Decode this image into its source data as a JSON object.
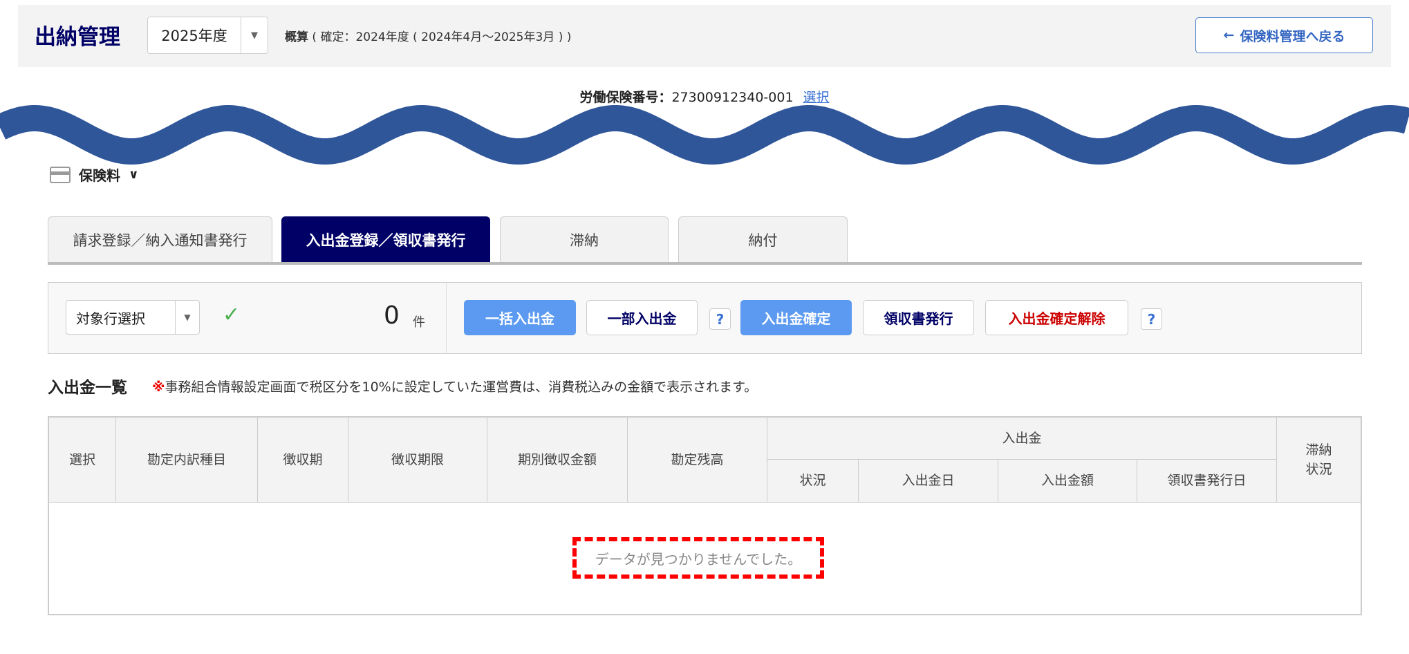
{
  "header": {
    "title": "出納管理",
    "year": "2025年度",
    "gaisan_label": "概算",
    "gaisan_detail": "( 確定：2024年度 ( 2024年4月～2025年3月 ) )",
    "back_button": "保険料管理へ戻る"
  },
  "insurance": {
    "label": "労働保険番号：",
    "number": "27300912340-001",
    "select_link": "選択"
  },
  "section": {
    "title": "保険料"
  },
  "tabs": [
    {
      "label": "請求登録／納入通知書発行"
    },
    {
      "label": "入出金登録／領収書発行",
      "active": true
    },
    {
      "label": "滞納"
    },
    {
      "label": "納付"
    }
  ],
  "toolbar": {
    "row_select": "対象行選択",
    "count": "0",
    "count_unit": "件",
    "buttons": [
      "一括入出金",
      "一部入出金",
      "入出金確定",
      "領収書発行",
      "入出金確定解除"
    ],
    "help": "?"
  },
  "list": {
    "title": "入出金一覧",
    "note_mark": "※",
    "note": "事務組合情報設定画面で税区分を10%に設定していた運営費は、消費税込みの金額で表示されます。"
  },
  "table": {
    "headers": [
      "選択",
      "勘定内訳種目",
      "徴収期",
      "徴収期限",
      "期別徴収金額",
      "勘定残高"
    ],
    "group": "入出金",
    "sub_headers": [
      "状況",
      "入出金日",
      "入出金額",
      "領収書発行日"
    ],
    "last": "滞納\n状況",
    "empty": "データが見つかりませんでした。"
  },
  "colors": {
    "navy": "#000066",
    "accent_blue": "#5b9af0",
    "link": "#3a72d4",
    "danger": "#cc0000",
    "wave": "#30569a",
    "highlight": "#ff0000"
  }
}
